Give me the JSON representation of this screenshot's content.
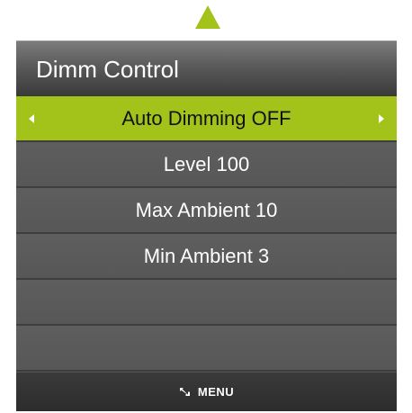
{
  "colors": {
    "accent": "#a3c31b",
    "panel": "#555555",
    "footer": "#2c2c2c",
    "text": "#ffffff",
    "selected_text": "#111111"
  },
  "nav": {
    "up_icon": "up-triangle-icon"
  },
  "menu": {
    "title": "Dimm Control",
    "items": [
      {
        "label": "Auto Dimming OFF",
        "selected": true,
        "left_icon": "chevron-left-icon",
        "right_icon": "chevron-right-icon"
      },
      {
        "label": "Level 100",
        "selected": false
      },
      {
        "label": "Max Ambient 10",
        "selected": false
      },
      {
        "label": "Min Ambient 3",
        "selected": false
      },
      {
        "label": "",
        "selected": false
      },
      {
        "label": "",
        "selected": false
      }
    ]
  },
  "footer": {
    "icon": "return-arrow-icon",
    "label": "MENU"
  }
}
